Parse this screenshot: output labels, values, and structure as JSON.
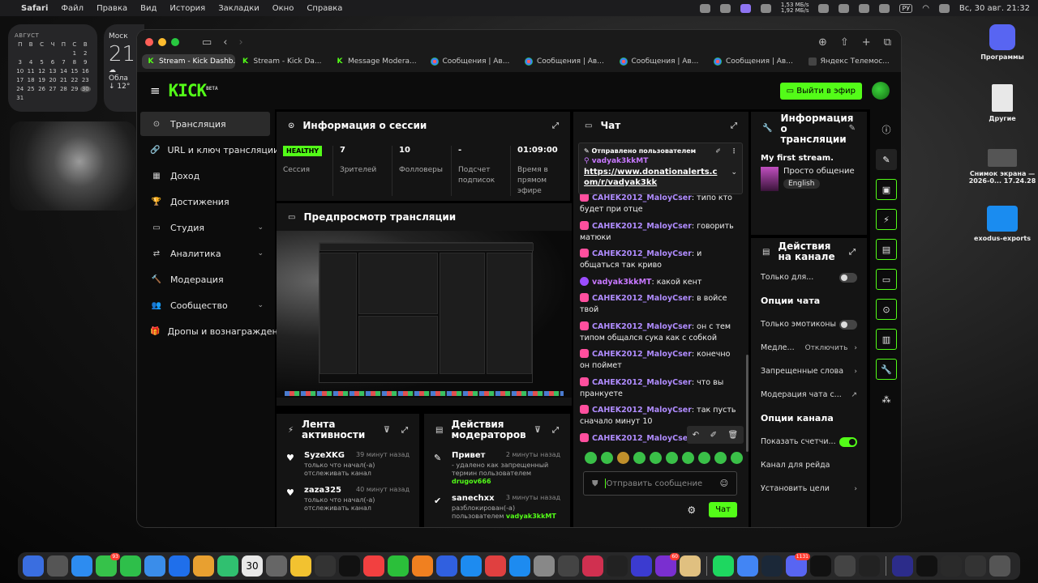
{
  "menubar": {
    "apple": "",
    "app": "Safari",
    "items": [
      "Файл",
      "Правка",
      "Вид",
      "История",
      "Закладки",
      "Окно",
      "Справка"
    ],
    "net_up": "1,53 МБ/s",
    "net_down": "1,92 МБ/s",
    "lang": "РУ",
    "datetime": "Вс, 30 авг.  21:32"
  },
  "calendar": {
    "month": "АВГУСТ",
    "days": [
      "П",
      "В",
      "С",
      "Ч",
      "П",
      "С",
      "В"
    ],
    "weeks": [
      [
        "",
        "",
        "",
        "",
        "1",
        "2"
      ],
      [
        "3",
        "4",
        "5",
        "6",
        "7",
        "8",
        "9"
      ],
      [
        "10",
        "11",
        "12",
        "13",
        "14",
        "15",
        "16"
      ],
      [
        "17",
        "18",
        "19",
        "20",
        "21",
        "22",
        "23"
      ],
      [
        "24",
        "25",
        "26",
        "27",
        "28",
        "29",
        "30"
      ],
      [
        "31"
      ]
    ],
    "today": "30"
  },
  "weather": {
    "city": "Моск",
    "temp": "21",
    "cond": "Обла",
    "low": "↓ 12°"
  },
  "desktop": {
    "discord": "Программы",
    "doc": "Другие",
    "screenshot": "Снимок экрана — 2026-0... 17.24.28",
    "folder": "exodus-exports"
  },
  "browser": {
    "tabs": [
      "Stream - Kick Dashb...",
      "Stream - Kick Da...",
      "Message Modera...",
      "Сообщения | Ав...",
      "Сообщения | Ав...",
      "Сообщения | Ав...",
      "Сообщения | Ав...",
      "Яндекс Телемос..."
    ]
  },
  "kick": {
    "logo": "KICK",
    "beta": "BETA",
    "go_live": "Выйти в эфир"
  },
  "sidebar": {
    "items": [
      {
        "label": "Трансляция",
        "icon": "⊙",
        "chev": ""
      },
      {
        "label": "URL и ключ трансляции",
        "icon": "🔗",
        "chev": ""
      },
      {
        "label": "Доход",
        "icon": "▦",
        "chev": ""
      },
      {
        "label": "Достижения",
        "icon": "🏆",
        "chev": ""
      },
      {
        "label": "Студия",
        "icon": "▭",
        "chev": "⌄"
      },
      {
        "label": "Аналитика",
        "icon": "⇄",
        "chev": "⌄"
      },
      {
        "label": "Модерация",
        "icon": "🔨",
        "chev": ""
      },
      {
        "label": "Сообщество",
        "icon": "👥",
        "chev": "⌄"
      },
      {
        "label": "Дропы и вознаграждени",
        "icon": "🎁",
        "chev": ""
      }
    ]
  },
  "session": {
    "title": "Информация о сессии",
    "health": "HEALTHY",
    "health_label": "Сессия",
    "stats": [
      {
        "v": "7",
        "l": "Зрителей"
      },
      {
        "v": "10",
        "l": "Фолловеры"
      },
      {
        "v": "-",
        "l": "Подсчет подписок"
      },
      {
        "v": "01:09:00",
        "l": "Время в прямом эфире"
      }
    ]
  },
  "preview": {
    "title": "Предпросмотр трансляции"
  },
  "activity": {
    "title": "Лента активности",
    "items": [
      {
        "name": "SyzeXKG",
        "time": "39 минут назад",
        "desc": "только что начал(-а) отслеживать канал"
      },
      {
        "name": "zaza325",
        "time": "40 минут назад",
        "desc": "только что начал(-а) отслеживать канал"
      }
    ]
  },
  "modactions": {
    "title": "Действия модераторов",
    "items": [
      {
        "name": "Привет",
        "time": "2 минуты назад",
        "desc": "- удалено как запрещенный термин пользователем",
        "user": "drugov666"
      },
      {
        "name": "sanechxx",
        "time": "3 минуты назад",
        "desc": "разблокирован(-а) пользователем",
        "user": "vadyak3kkMT"
      }
    ]
  },
  "chat": {
    "title": "Чат",
    "pinned_header": "Отправлено пользователем",
    "pinned_user": "vadyak3kkMT",
    "pinned_link": "https://www.donationalerts.com/r/vadyak3kk",
    "messages": [
      {
        "u": "CAHEK2012_MaloyCser",
        "t": "типо кто будет при отце",
        "mod": false
      },
      {
        "u": "CAHEK2012_MaloyCser",
        "t": "говорить матюки",
        "mod": false
      },
      {
        "u": "CAHEK2012_MaloyCser",
        "t": "и общаться так криво",
        "mod": false
      },
      {
        "u": "vadyak3kkMT",
        "t": "какой кент",
        "mod": true
      },
      {
        "u": "CAHEK2012_MaloyCser",
        "t": "в войсе твой",
        "mod": false
      },
      {
        "u": "CAHEK2012_MaloyCser",
        "t": "он с тем типом общался сука как с собкой",
        "mod": false
      },
      {
        "u": "CAHEK2012_MaloyCser",
        "t": "конечно он поймет",
        "mod": false
      },
      {
        "u": "CAHEK2012_MaloyCser",
        "t": "что вы пранкуете",
        "mod": false
      },
      {
        "u": "CAHEK2012_MaloyCser",
        "t": "так пусть сначало минут 10",
        "mod": false
      },
      {
        "u": "CAHEK2012_MaloyCser",
        "t": "",
        "mod": false
      }
    ],
    "placeholder": "Отправить сообщение",
    "send": "Чат"
  },
  "streaminfo": {
    "title": "Информация о трансляции",
    "stream_title": "My first stream.",
    "category": "Просто общение",
    "language": "English"
  },
  "channel": {
    "title": "Действия на канале",
    "rows": [
      {
        "type": "opt",
        "label": "Только для...",
        "toggle": "off"
      },
      {
        "type": "sec",
        "label": "Опции чата"
      },
      {
        "type": "opt",
        "label": "Только эмотиконы",
        "toggle": "off"
      },
      {
        "type": "opt",
        "label": "Медле...",
        "value": "Отключить",
        "chev": "›"
      },
      {
        "type": "opt",
        "label": "Запрещенные слова",
        "chev": "›"
      },
      {
        "type": "opt",
        "label": "Модерация чата с...",
        "chev": "↗"
      },
      {
        "type": "sec",
        "label": "Опции канала"
      },
      {
        "type": "opt",
        "label": "Показать счетчи...",
        "toggle": "on"
      },
      {
        "type": "opt",
        "label": "Канал для рейда"
      },
      {
        "type": "opt",
        "label": "Установить цели",
        "chev": "›"
      }
    ]
  },
  "dock": {
    "calendar_day": "30"
  }
}
